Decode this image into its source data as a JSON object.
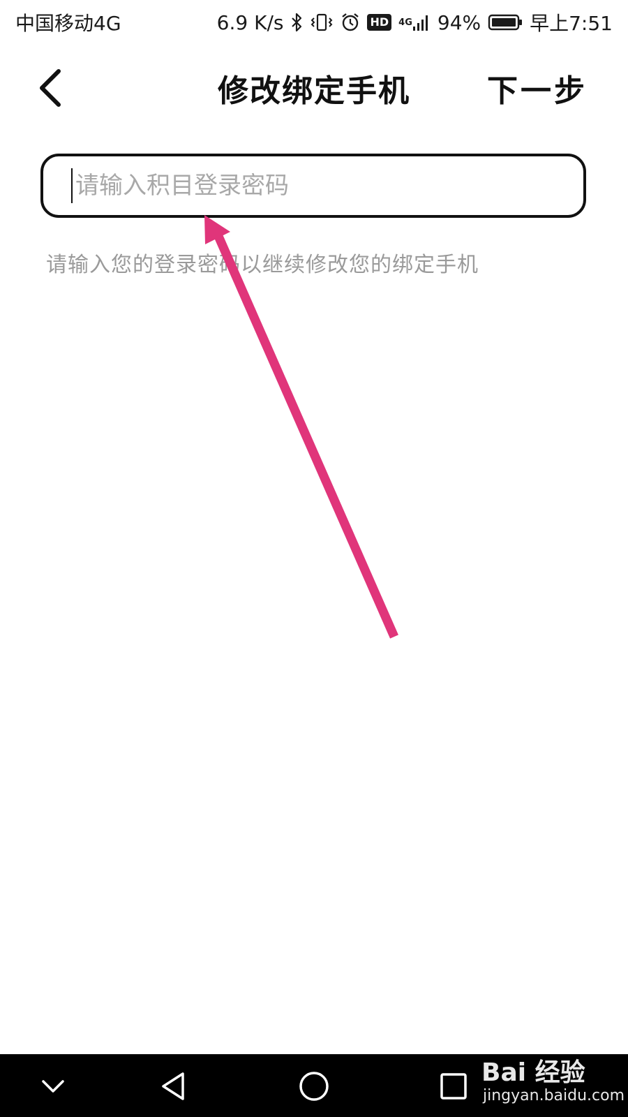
{
  "status_bar": {
    "carrier": "中国移动4G",
    "network_speed": "6.9 K/s",
    "hd_label": "HD",
    "network_type": "4G",
    "battery": "94%",
    "time": "早上7:51",
    "icons": [
      "bluetooth-icon",
      "vibrate-icon",
      "alarm-icon",
      "hd-icon",
      "signal-icon",
      "battery-icon"
    ]
  },
  "header": {
    "back_icon": "chevron-left-icon",
    "title": "修改绑定手机",
    "next_label": "下一步"
  },
  "form": {
    "password_placeholder": "请输入积目登录密码",
    "password_value": "",
    "hint": "请输入您的登录密码以继续修改您的绑定手机"
  },
  "annotation": {
    "arrow_color": "#e0357a"
  },
  "nav_bar": {
    "buttons": [
      "chevron-down-icon",
      "back-triangle-icon",
      "home-circle-icon",
      "recents-square-icon"
    ]
  },
  "watermark": {
    "brand": "Bai 经验",
    "url": "jingyan.baidu.com"
  }
}
